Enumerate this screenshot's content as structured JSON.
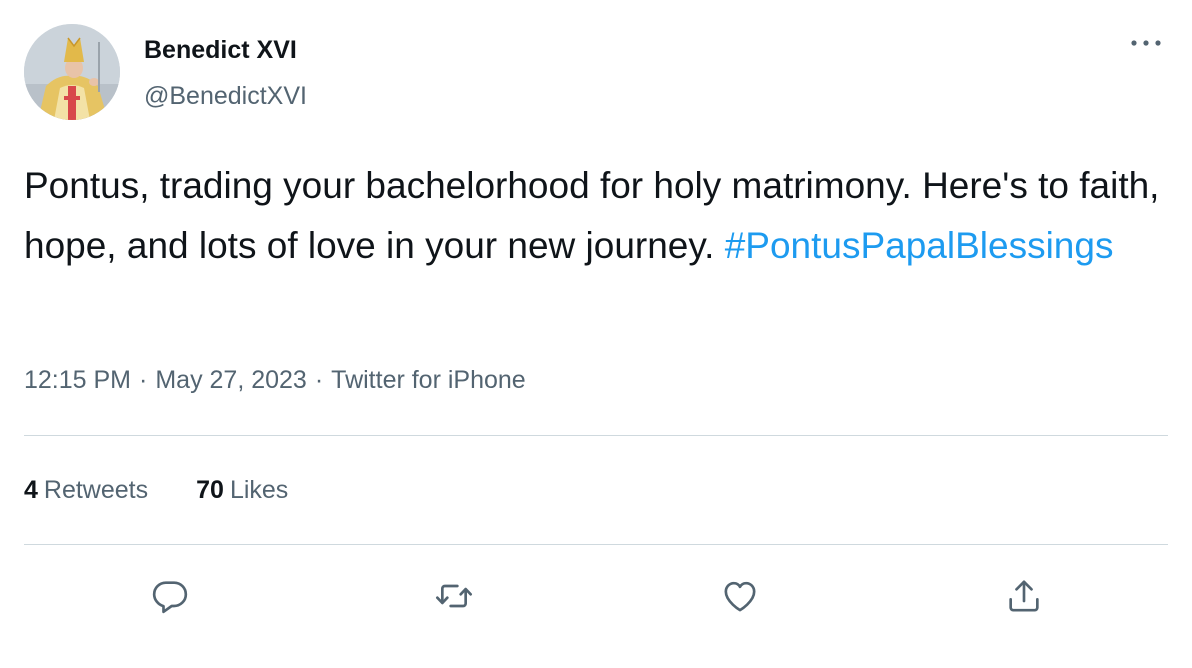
{
  "author": {
    "display_name": "Benedict XVI",
    "handle": "@BenedictXVI",
    "avatar_icon": "profile-photo-pope"
  },
  "tweet": {
    "text": "Pontus, trading your bachelorhood for holy matrimony. Here's to faith, hope, and lots of love in your new journey.",
    "hashtag": "#PontusPapalBlessings"
  },
  "meta": {
    "time": "12:15 PM",
    "separator": "·",
    "date": "May 27, 2023",
    "source": "Twitter for iPhone"
  },
  "stats": {
    "retweets_count": "4",
    "retweets_label": "Retweets",
    "likes_count": "70",
    "likes_label": "Likes"
  },
  "actions": {
    "icons": [
      "reply-icon",
      "retweet-icon",
      "like-icon",
      "share-icon"
    ]
  },
  "colors": {
    "text": "#0f1419",
    "secondary": "#536471",
    "accent": "#1d9bf0",
    "divider": "#cfd9de"
  }
}
